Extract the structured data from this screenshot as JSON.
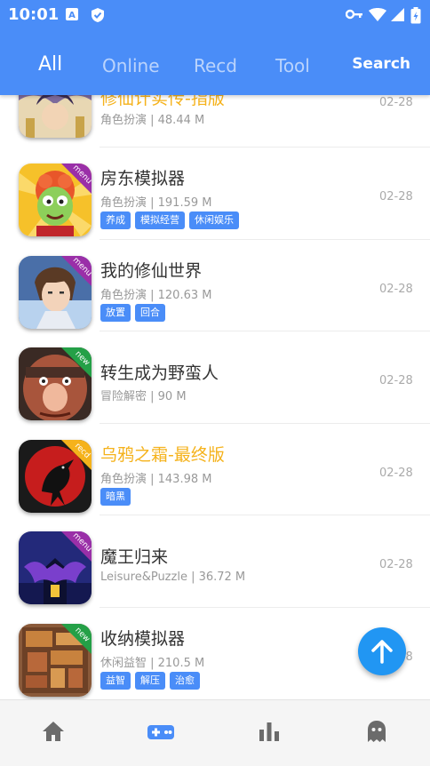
{
  "status": {
    "time": "10:01"
  },
  "tabs": [
    {
      "label": "All",
      "active": true
    },
    {
      "label": "Online",
      "active": false
    },
    {
      "label": "Recd",
      "active": false
    },
    {
      "label": "Tool",
      "active": false
    }
  ],
  "search_label": "Search",
  "accent_color": "#4a8df8",
  "highlight_color": "#f5b21b",
  "games": [
    {
      "title": "修仙计实传-指版",
      "meta": "角色扮演 | 48.44 M",
      "date": "02-28",
      "tags": [],
      "badge": "",
      "highlighted": true,
      "partial": true
    },
    {
      "title": "房东模拟器",
      "meta": "角色扮演 | 191.59 M",
      "date": "02-28",
      "tags": [
        "养成",
        "模拟经营",
        "休闲娱乐"
      ],
      "badge": "menu"
    },
    {
      "title": "我的修仙世界",
      "meta": "角色扮演 | 120.63 M",
      "date": "02-28",
      "tags": [
        "放置",
        "回合"
      ],
      "badge": "menu"
    },
    {
      "title": "转生成为野蛮人",
      "meta": "冒险解密 | 90 M",
      "date": "02-28",
      "tags": [],
      "badge": "new"
    },
    {
      "title": "乌鸦之霜-最终版",
      "meta": "角色扮演 | 143.98 M",
      "date": "02-28",
      "tags": [
        "暗黑"
      ],
      "badge": "recd",
      "highlighted": true
    },
    {
      "title": "魔王归来",
      "meta": "Leisure&Puzzle | 36.72 M",
      "date": "02-28",
      "tags": [],
      "badge": "menu"
    },
    {
      "title": "收纳模拟器",
      "meta": "休闲益智 | 210.5 M",
      "date": "02-28",
      "tags": [
        "益智",
        "解压",
        "治愈"
      ],
      "badge": "new"
    }
  ],
  "nav": [
    "home-icon",
    "gamepad-icon",
    "chart-icon",
    "ghost-icon"
  ]
}
